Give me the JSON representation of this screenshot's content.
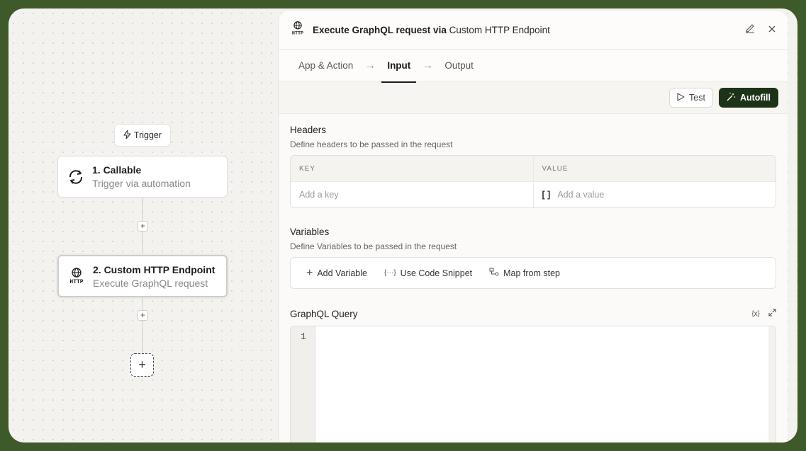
{
  "canvas": {
    "trigger_chip": "Trigger",
    "nodes": [
      {
        "title": "1. Callable",
        "subtitle": "Trigger via automation"
      },
      {
        "title": "2. Custom HTTP Endpoint",
        "subtitle": "Execute GraphQL request"
      }
    ],
    "http_badge": "HTTP"
  },
  "panel": {
    "title_main": "Execute GraphQL request via ",
    "title_app": "Custom HTTP Endpoint",
    "tabs": [
      "App & Action",
      "Input",
      "Output"
    ],
    "active_tab": "Input",
    "test_label": "Test",
    "autofill_label": "Autofill",
    "headers": {
      "title": "Headers",
      "description": "Define headers to be passed in the request",
      "col_key": "KEY",
      "col_value": "VALUE",
      "key_placeholder": "Add a key",
      "value_placeholder": "Add a value",
      "value_prefix": "[ ]"
    },
    "variables": {
      "title": "Variables",
      "description": "Define Variables to be passed in the request",
      "add_variable": "Add Variable",
      "use_code_snippet": "Use Code Snippet",
      "map_from_step": "Map from step",
      "snippet_glyph": "{···}"
    },
    "query": {
      "title": "GraphQL Query",
      "line_number": "1",
      "var_glyph": "{x}"
    }
  },
  "colors": {
    "outer_bg": "#3f5a2a",
    "autofill_bg": "#1d3318"
  }
}
